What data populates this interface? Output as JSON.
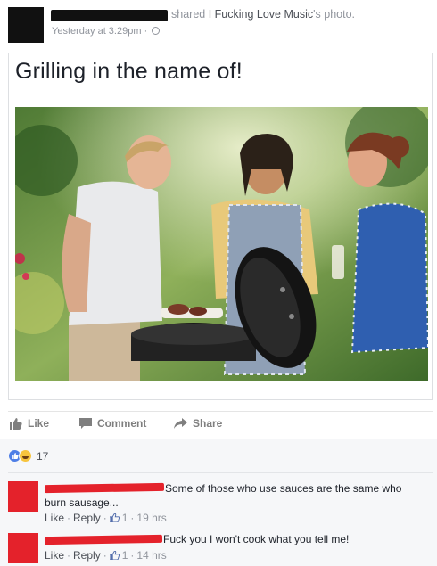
{
  "post": {
    "shared_text": "shared",
    "page_name": "I Fucking Love Music",
    "photo_suffix": "'s photo.",
    "timestamp": "Yesterday at 3:29pm",
    "visibility_icon": "globe-icon"
  },
  "photo_card": {
    "caption": "Grilling in the name of!"
  },
  "actions": {
    "like": "Like",
    "comment": "Comment",
    "share": "Share"
  },
  "reactions": {
    "icons": [
      "like-icon",
      "haha-icon"
    ],
    "count": "17"
  },
  "comments": [
    {
      "text_line1": "Some of those who use sauces are the same who",
      "text_line2": "burn sausage...",
      "like": "Like",
      "reply": "Reply",
      "likes": "1",
      "time": "19 hrs"
    },
    {
      "text_line1": "Fuck you I won't cook what you tell me!",
      "like": "Like",
      "reply": "Reply",
      "likes": "1",
      "time": "14 hrs"
    }
  ],
  "colors": {
    "link_blue": "#4267b2",
    "muted": "#90949c",
    "redaction_red": "#e4222b"
  }
}
